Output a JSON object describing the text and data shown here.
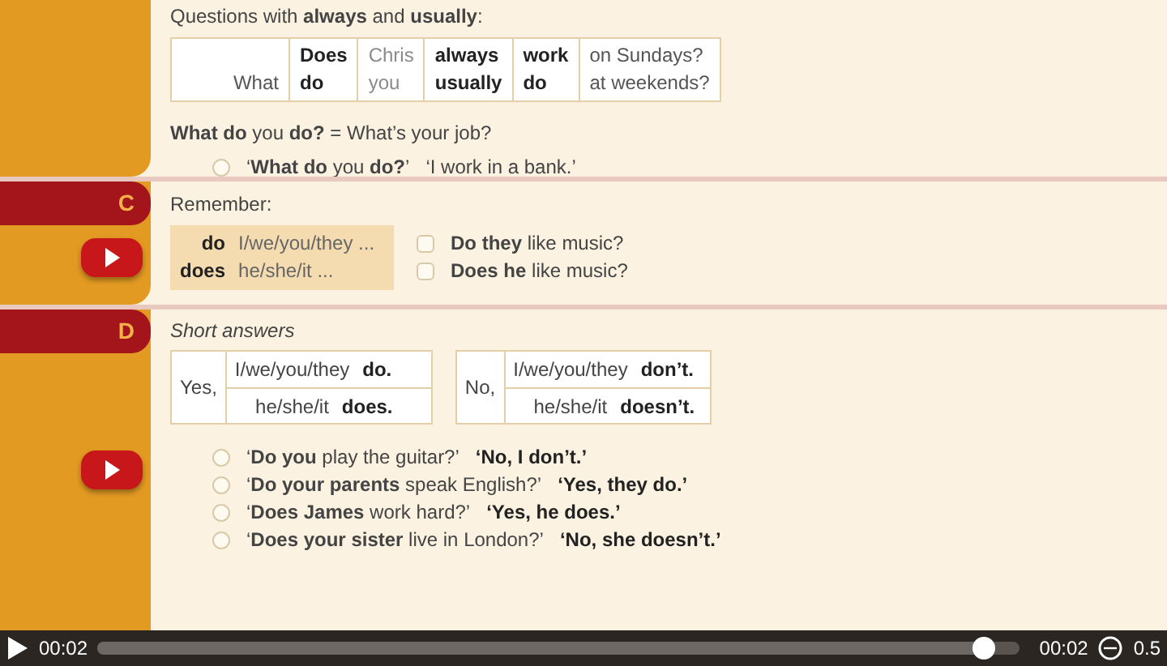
{
  "section_b": {
    "heading": "Questions with **always** and **usually**:",
    "question_table": [
      {
        "bottom": "What",
        "kind": "question_word"
      },
      {
        "top": "Does",
        "bottom": "do",
        "kind": "auxiliary"
      },
      {
        "top": "Chris",
        "bottom": "you",
        "kind": "subject"
      },
      {
        "top": "always",
        "bottom": "usually",
        "kind": "adverb"
      },
      {
        "top": "work",
        "bottom": "do",
        "kind": "verb"
      },
      {
        "top": "on Sundays?",
        "bottom": "at weekends?",
        "kind": "time"
      }
    ],
    "note": "**What do** you **do?** = What’s your job?",
    "examples": [
      {
        "question": "‘**What do** you **do?**’",
        "answer": "‘I work in a bank.’"
      }
    ]
  },
  "section_c": {
    "letter": "C",
    "heading": "Remember:",
    "remember_box": [
      {
        "verb": "do",
        "subjects": "I/we/you/they ..."
      },
      {
        "verb": "does",
        "subjects": "he/she/it ..."
      }
    ],
    "examples": [
      {
        "text": "**Do they** like music?"
      },
      {
        "text": "**Does he** like music?"
      }
    ]
  },
  "section_d": {
    "letter": "D",
    "heading": "Short answers",
    "answer_tables": [
      {
        "lead": "Yes,",
        "rows": [
          {
            "subjects": "I/we/you/they",
            "verb": "do."
          },
          {
            "subjects": "he/she/it",
            "verb": "does."
          }
        ]
      },
      {
        "lead": "No,",
        "rows": [
          {
            "subjects": "I/we/you/they",
            "verb": "don’t."
          },
          {
            "subjects": "he/she/it",
            "verb": "doesn’t."
          }
        ]
      }
    ],
    "examples": [
      {
        "question": "‘**Do you** play the guitar?’",
        "answer": "‘No, I don’t.’"
      },
      {
        "question": "‘**Do your parents** speak English?’",
        "answer": "‘Yes, they do.’"
      },
      {
        "question": "‘**Does James** work hard?’",
        "answer": "‘Yes, he does.’"
      },
      {
        "question": "‘**Does your sister** live in London?’",
        "answer": "‘No, she doesn’t.’"
      }
    ]
  },
  "player": {
    "current_time": "00:02",
    "level": 0.96,
    "duration": "00:02",
    "speed": "0.5"
  }
}
